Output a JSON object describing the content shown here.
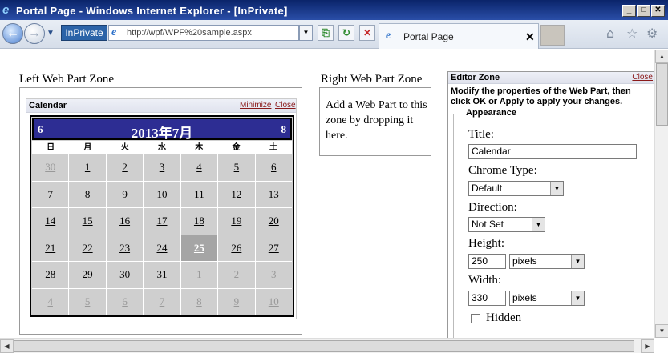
{
  "window": {
    "title": "Portal Page - Windows Internet Explorer - [InPrivate]",
    "min_glyph": "_",
    "max_glyph": "□",
    "close_glyph": "✕"
  },
  "toolbar": {
    "back_glyph": "←",
    "forward_glyph": "→",
    "dropdown_glyph": "▼",
    "inprivate_label": "InPrivate",
    "url": "http://wpf/WPF%20sample.aspx",
    "addr_dropdown_glyph": "▼",
    "compat_glyph": "⎘",
    "refresh_glyph": "↻",
    "stop_glyph": "✕",
    "tab_label": "Portal Page",
    "tab_close": "✕",
    "home_glyph": "⌂",
    "favorites_glyph": "☆",
    "tools_glyph": "⚙"
  },
  "page": {
    "left_zone_title": "Left Web Part Zone",
    "right_zone_title": "Right Web Part Zone",
    "right_zone_message": "Add a Web Part to this zone by dropping it here.",
    "calendar_part": {
      "title": "Calendar",
      "minimize_label": "Minimize",
      "close_label": "Close"
    },
    "calendar": {
      "prev_label": "6",
      "next_label": "8",
      "month_label": "2013年7月",
      "day_names": [
        "日",
        "月",
        "火",
        "水",
        "木",
        "金",
        "土"
      ],
      "today": "25",
      "weeks": [
        [
          {
            "d": "30",
            "o": true
          },
          {
            "d": "1"
          },
          {
            "d": "2"
          },
          {
            "d": "3"
          },
          {
            "d": "4"
          },
          {
            "d": "5"
          },
          {
            "d": "6"
          }
        ],
        [
          {
            "d": "7"
          },
          {
            "d": "8"
          },
          {
            "d": "9"
          },
          {
            "d": "10"
          },
          {
            "d": "11"
          },
          {
            "d": "12"
          },
          {
            "d": "13"
          }
        ],
        [
          {
            "d": "14"
          },
          {
            "d": "15"
          },
          {
            "d": "16"
          },
          {
            "d": "17"
          },
          {
            "d": "18"
          },
          {
            "d": "19"
          },
          {
            "d": "20"
          }
        ],
        [
          {
            "d": "21"
          },
          {
            "d": "22"
          },
          {
            "d": "23"
          },
          {
            "d": "24"
          },
          {
            "d": "25",
            "t": true
          },
          {
            "d": "26"
          },
          {
            "d": "27"
          }
        ],
        [
          {
            "d": "28"
          },
          {
            "d": "29"
          },
          {
            "d": "30"
          },
          {
            "d": "31"
          },
          {
            "d": "1",
            "o": true
          },
          {
            "d": "2",
            "o": true
          },
          {
            "d": "3",
            "o": true
          }
        ],
        [
          {
            "d": "4",
            "o": true
          },
          {
            "d": "5",
            "o": true
          },
          {
            "d": "6",
            "o": true
          },
          {
            "d": "7",
            "o": true
          },
          {
            "d": "8",
            "o": true
          },
          {
            "d": "9",
            "o": true
          },
          {
            "d": "10",
            "o": true
          }
        ]
      ]
    }
  },
  "editor": {
    "title": "Editor Zone",
    "close_label": "Close",
    "instructions": "Modify the properties of the Web Part, then click OK or Apply to apply your changes.",
    "appearance_legend": "Appearance",
    "title_label": "Title:",
    "title_value": "Calendar",
    "chrome_type_label": "Chrome Type:",
    "chrome_type_value": "Default",
    "direction_label": "Direction:",
    "direction_value": "Not Set",
    "height_label": "Height:",
    "height_value": "250",
    "height_unit": "pixels",
    "width_label": "Width:",
    "width_value": "330",
    "width_unit": "pixels",
    "hidden_label": "Hidden",
    "select_arrow": "▼"
  },
  "scrollbars": {
    "up_glyph": "▲",
    "down_glyph": "▼",
    "left_glyph": "◀",
    "right_glyph": "▶"
  },
  "colors": {
    "titlebar": "#0a246a",
    "calendar_title_bg": "#2d2d93",
    "day_cell": "#cfcfcf",
    "today_cell": "#a5a5a5",
    "verb_link": "#8b1a1a"
  }
}
